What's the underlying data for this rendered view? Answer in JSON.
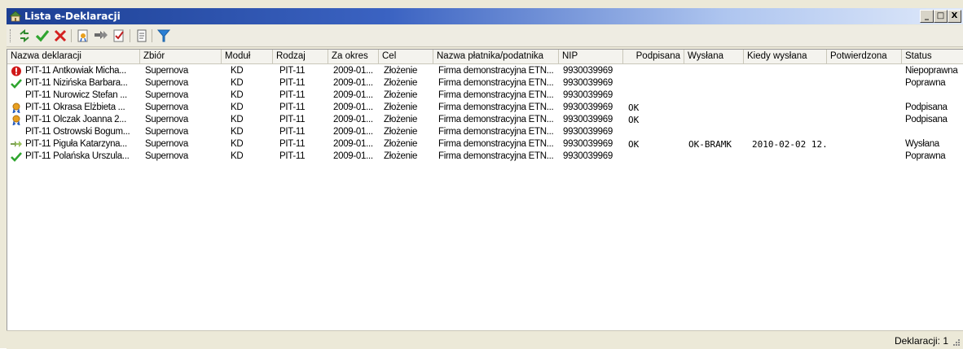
{
  "window": {
    "title": "Lista e-Deklaracji",
    "controls": [
      "_",
      "□",
      "X"
    ]
  },
  "toolbar": {
    "buttons": [
      "refresh-icon",
      "check-icon",
      "cross-icon",
      "sign-icon",
      "send-icon",
      "check-status-icon",
      "report-icon",
      "filter-icon"
    ]
  },
  "columns": [
    "Nazwa deklaracji",
    "Zbiór",
    "Moduł",
    "Rodzaj",
    "Za okres",
    "Cel",
    "Nazwa płatnika/podatnika",
    "NIP",
    "Podpisana",
    "Wysłana",
    "Kiedy wysłana",
    "Potwierdzona",
    "Status"
  ],
  "rows": [
    {
      "icon": "error-icon",
      "c": [
        "PIT-11 Antkowiak Micha...",
        "Supernova",
        "KD",
        "PIT-11",
        "2009-01...",
        "Złożenie",
        "Firma demonstracyjna ETN...",
        "9930039969",
        "",
        "",
        "",
        "",
        "Niepoprawna"
      ]
    },
    {
      "icon": "valid-check-icon",
      "c": [
        "PIT-11 Nizińska Barbara...",
        "Supernova",
        "KD",
        "PIT-11",
        "2009-01...",
        "Złożenie",
        "Firma demonstracyjna ETN...",
        "9930039969",
        "",
        "",
        "",
        "",
        "Poprawna"
      ]
    },
    {
      "icon": "",
      "c": [
        "PIT-11 Nurowicz Stefan ...",
        "Supernova",
        "KD",
        "PIT-11",
        "2009-01...",
        "Złożenie",
        "Firma demonstracyjna ETN...",
        "9930039969",
        "",
        "",
        "",
        "",
        ""
      ]
    },
    {
      "icon": "signed-ribbon-icon",
      "c": [
        "PIT-11 Okrasa Elżbieta ...",
        "Supernova",
        "KD",
        "PIT-11",
        "2009-01...",
        "Złożenie",
        "Firma demonstracyjna ETN...",
        "9930039969",
        "OK",
        "",
        "",
        "",
        "Podpisana"
      ]
    },
    {
      "icon": "signed-ribbon-icon",
      "c": [
        "PIT-11 Olczak Joanna 2...",
        "Supernova",
        "KD",
        "PIT-11",
        "2009-01...",
        "Złożenie",
        "Firma demonstracyjna ETN...",
        "9930039969",
        "OK",
        "",
        "",
        "",
        "Podpisana"
      ]
    },
    {
      "icon": "",
      "c": [
        "PIT-11 Ostrowski Bogum...",
        "Supernova",
        "KD",
        "PIT-11",
        "2009-01...",
        "Złożenie",
        "Firma demonstracyjna ETN...",
        "9930039969",
        "",
        "",
        "",
        "",
        ""
      ]
    },
    {
      "icon": "sent-arrow-icon",
      "c": [
        "PIT-11 Piguła Katarzyna...",
        "Supernova",
        "KD",
        "PIT-11",
        "2009-01...",
        "Złożenie",
        "Firma demonstracyjna ETN...",
        "9930039969",
        "OK",
        "OK-BRAMK",
        "2010-02-02 12...",
        "",
        "Wysłana"
      ]
    },
    {
      "icon": "valid-check-icon",
      "c": [
        "PIT-11 Polańska Urszula...",
        "Supernova",
        "KD",
        "PIT-11",
        "2009-01...",
        "Złożenie",
        "Firma demonstracyjna ETN...",
        "9930039969",
        "",
        "",
        "",
        "",
        "Poprawna"
      ]
    }
  ],
  "statusbar": {
    "text": "Deklaracji: 1"
  },
  "colors": {
    "title_start": "#1c3f93",
    "title_end": "#dfe9fa",
    "check": "#2fa52f",
    "cross": "#d42020",
    "filter": "#2a7fd4",
    "error": "#d01818"
  }
}
